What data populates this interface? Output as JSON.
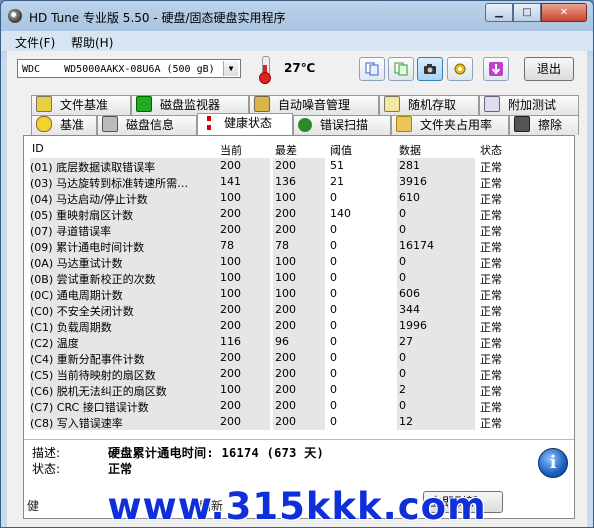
{
  "window": {
    "title": "HD Tune 专业版 5.50 - 硬盘/固态硬盘实用程序",
    "min": "▁",
    "max": "□",
    "close": "✕"
  },
  "menu": {
    "file": "文件(F)",
    "help": "帮助(H)"
  },
  "toolbar": {
    "drive": "WDC    WD5000AAKX-08U6A (500 gB)",
    "temperature": "27℃",
    "exit": "退出"
  },
  "tabs_top": [
    "文件基准",
    "磁盘监视器",
    "自动噪音管理",
    "随机存取",
    "附加测试"
  ],
  "tabs_bottom": [
    "基准",
    "磁盘信息",
    "健康状态",
    "错误扫描",
    "文件夹占用率",
    "擦除"
  ],
  "active_tab": "健康状态",
  "columns": {
    "id": "ID",
    "current": "当前",
    "worst": "最差",
    "threshold": "阈值",
    "data": "数据",
    "status": "状态"
  },
  "rows": [
    {
      "id": "(01) 底层数据读取错误率",
      "cur": "200",
      "worst": "200",
      "thr": "51",
      "data": "281",
      "status": "正常"
    },
    {
      "id": "(03) 马达旋转到标准转速所需…",
      "cur": "141",
      "worst": "136",
      "thr": "21",
      "data": "3916",
      "status": "正常"
    },
    {
      "id": "(04) 马达启动/停止计数",
      "cur": "100",
      "worst": "100",
      "thr": "0",
      "data": "610",
      "status": "正常"
    },
    {
      "id": "(05) 重映射扇区计数",
      "cur": "200",
      "worst": "200",
      "thr": "140",
      "data": "0",
      "status": "正常"
    },
    {
      "id": "(07) 寻道错误率",
      "cur": "200",
      "worst": "200",
      "thr": "0",
      "data": "0",
      "status": "正常"
    },
    {
      "id": "(09) 累计通电时间计数",
      "cur": "78",
      "worst": "78",
      "thr": "0",
      "data": "16174",
      "status": "正常"
    },
    {
      "id": "(0A) 马达重试计数",
      "cur": "100",
      "worst": "100",
      "thr": "0",
      "data": "0",
      "status": "正常"
    },
    {
      "id": "(0B) 尝试重新校正的次数",
      "cur": "100",
      "worst": "100",
      "thr": "0",
      "data": "0",
      "status": "正常"
    },
    {
      "id": "(0C) 通电周期计数",
      "cur": "100",
      "worst": "100",
      "thr": "0",
      "data": "606",
      "status": "正常"
    },
    {
      "id": "(C0) 不安全关闭计数",
      "cur": "200",
      "worst": "200",
      "thr": "0",
      "data": "344",
      "status": "正常"
    },
    {
      "id": "(C1) 负载周期数",
      "cur": "200",
      "worst": "200",
      "thr": "0",
      "data": "1996",
      "status": "正常"
    },
    {
      "id": "(C2) 温度",
      "cur": "116",
      "worst": "96",
      "thr": "0",
      "data": "27",
      "status": "正常"
    },
    {
      "id": "(C4) 重新分配事件计数",
      "cur": "200",
      "worst": "200",
      "thr": "0",
      "data": "0",
      "status": "正常"
    },
    {
      "id": "(C5) 当前待映射的扇区数",
      "cur": "200",
      "worst": "200",
      "thr": "0",
      "data": "0",
      "status": "正常"
    },
    {
      "id": "(C6) 脱机无法纠正的扇区数",
      "cur": "100",
      "worst": "200",
      "thr": "0",
      "data": "2",
      "status": "正常"
    },
    {
      "id": "(C7) CRC 接口错误计数",
      "cur": "200",
      "worst": "200",
      "thr": "0",
      "data": "0",
      "status": "正常"
    },
    {
      "id": "(C8) 写入错误速率",
      "cur": "200",
      "worst": "200",
      "thr": "0",
      "data": "12",
      "status": "正常"
    }
  ],
  "detail": {
    "desc_label": "描述:",
    "desc_value": "硬盘累计通电时间: 16174 (673 天)",
    "status_label": "状态:",
    "status_value": "正常"
  },
  "bottom": {
    "log": "健",
    "refresh": "刷新",
    "now": "立即刷新"
  },
  "watermark": "www.315kkk.com",
  "colors": {
    "accent": "#0e2fd9",
    "row_shade": "#e6e6e6"
  }
}
